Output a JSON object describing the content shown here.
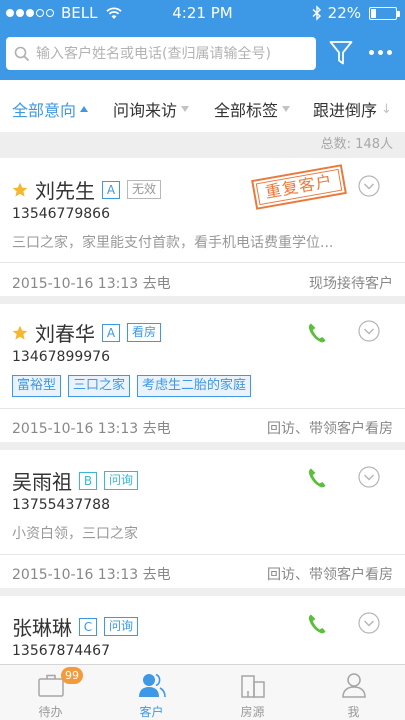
{
  "status_bar": {
    "carrier": "BELL",
    "time": "4:21 PM",
    "battery": "22%",
    "battery_level": 0.22,
    "signal_bars_filled": 3,
    "signal_bars_total": 5
  },
  "search": {
    "placeholder": "输入客户姓名或电话(查归属请输全号)",
    "value": ""
  },
  "icons": {
    "search": "search-icon",
    "filter": "funnel-icon",
    "more": "more-dots-icon",
    "star": "star-icon",
    "chevron": "chevron-down-circle-icon",
    "phone": "phone-icon"
  },
  "filters": [
    {
      "label": "全部意向",
      "active": true,
      "indicator": "up-triangle"
    },
    {
      "label": "问询来访",
      "active": false,
      "indicator": "down-triangle"
    },
    {
      "label": "全部标签",
      "active": false,
      "indicator": "down-triangle"
    },
    {
      "label": "跟进倒序",
      "active": false,
      "indicator": "down-arrow"
    }
  ],
  "total": "总数: 148人",
  "customers": [
    {
      "name": "刘先生",
      "starred": true,
      "level": "A",
      "status_tag": "无效",
      "phone": "13546779866",
      "note": "三口之家，家里能支付首款，看手机电话费重学位...",
      "stamp": "重复客户",
      "date": "2015-10-16 13:13 去电",
      "followup": "现场接待客户"
    },
    {
      "name": "刘春华",
      "starred": true,
      "level": "A",
      "status_tag": "看房",
      "phone": "13467899976",
      "tags": [
        "富裕型",
        "三口之家",
        "考虑生二胎的家庭"
      ],
      "date": "2015-10-16 13:13 去电",
      "followup": "回访、带领客户看房"
    },
    {
      "name": "吴雨祖",
      "starred": false,
      "level": "B",
      "status_tag": "问询",
      "phone": "13755437788",
      "note": "小资白领，三口之家",
      "date": "2015-10-16 13:13 去电",
      "followup": "回访、带领客户看房"
    },
    {
      "name": "张琳琳",
      "starred": false,
      "level": "C",
      "status_tag": "问询",
      "phone": "13567874467"
    }
  ],
  "tabbar": [
    {
      "label": "待办",
      "icon": "briefcase-icon",
      "badge": "99",
      "active": false
    },
    {
      "label": "客户",
      "icon": "users-icon",
      "active": true
    },
    {
      "label": "房源",
      "icon": "building-icon",
      "active": false
    },
    {
      "label": "我",
      "icon": "person-icon",
      "active": false
    }
  ],
  "colors": {
    "primary": "#3d98e6",
    "accent_orange": "#e97a3c",
    "badge_orange": "#f39a3d",
    "phone_green": "#5cbf3c",
    "star_yellow": "#f5b72c"
  }
}
